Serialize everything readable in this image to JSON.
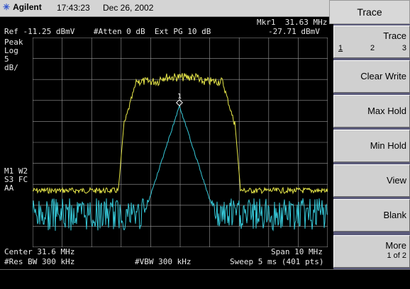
{
  "header": {
    "brand": "Agilent",
    "brand_icon": "agilent-spark-icon",
    "time": "17:43:23",
    "date": "Dec 26, 2002"
  },
  "display": {
    "marker_line1": "Mkr1  31.63 MHz",
    "marker_line2": "-27.71 dBmV",
    "ref_line": "Ref -11.25 dBmV    #Atten 0 dB  Ext PG 10 dB",
    "scale_type": "Peak",
    "scale_mode": "Log",
    "scale_value": "5",
    "scale_unit": "dB/",
    "trace_flags1": "M1 W2",
    "trace_flags2": "S3 FC",
    "trace_flags3": "AA",
    "marker_symbol": "1",
    "center": "Center 31.6 MHz",
    "span": "Span 10 MHz",
    "res_bw": "#Res BW 300 kHz",
    "vbw": "#VBW 300 kHz",
    "sweep": "Sweep 5 ms (401 pts)",
    "colors": {
      "trace1": "#e8e84a",
      "trace2": "#36c8d8",
      "grid": "#9a9a9a",
      "marker": "#ffffff"
    }
  },
  "softkeys": {
    "title": "Trace",
    "trace_select": {
      "label": "Trace",
      "options": [
        "1",
        "2",
        "3"
      ]
    },
    "clear_write": "Clear Write",
    "max_hold": "Max Hold",
    "min_hold": "Min Hold",
    "view": "View",
    "blank": "Blank",
    "more": "More",
    "more_sub": "1 of 2"
  }
}
